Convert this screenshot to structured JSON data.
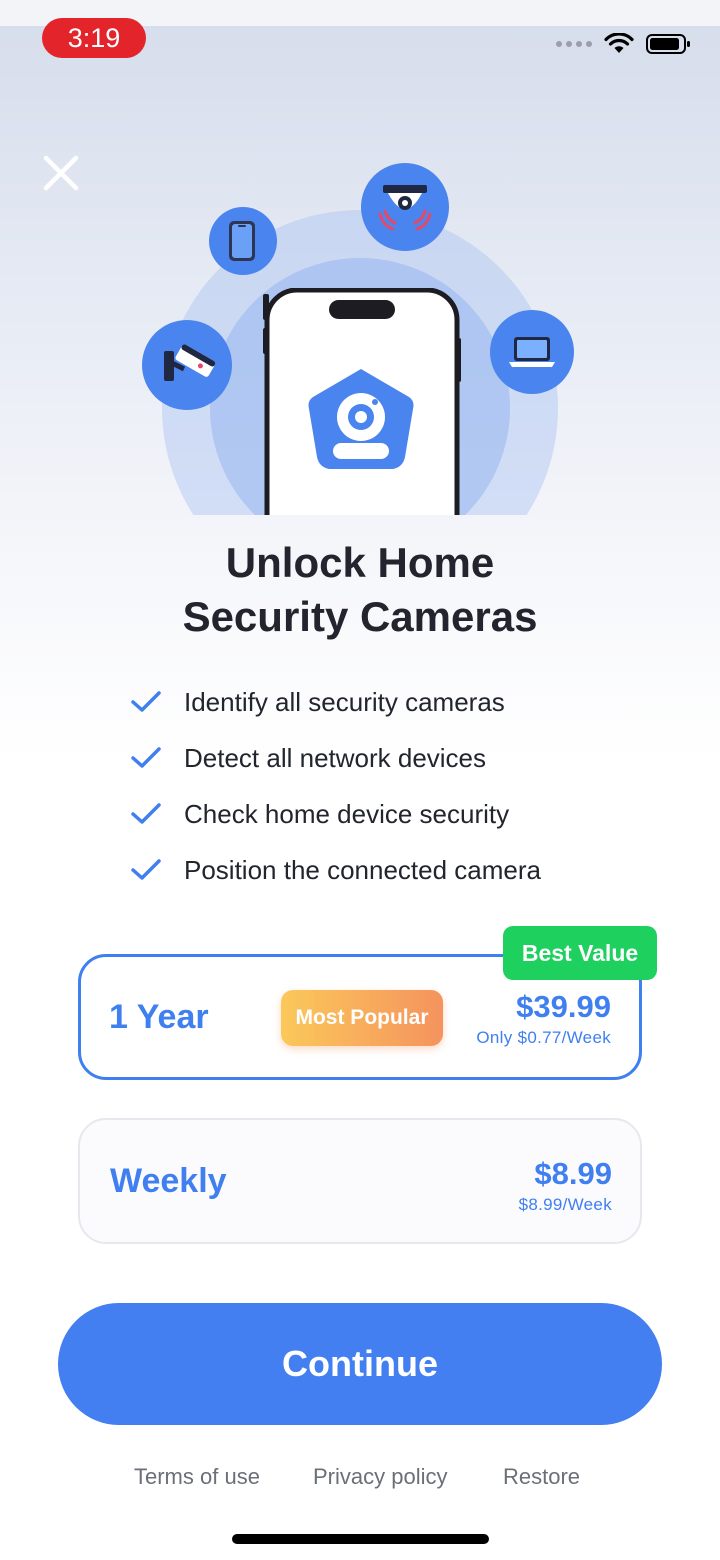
{
  "status_bar": {
    "time": "3:19"
  },
  "header": {
    "close_icon": "close-icon"
  },
  "hero": {
    "icons": [
      "smartphone-icon",
      "dome-camera-icon",
      "cctv-camera-icon",
      "laptop-icon",
      "home-camera-icon"
    ]
  },
  "title": {
    "line1": "Unlock Home",
    "line2": "Security Cameras"
  },
  "features": [
    "Identify all security cameras",
    "Detect all network devices",
    "Check home device security",
    "Position the connected camera"
  ],
  "plans": [
    {
      "name": "1 Year",
      "badge": "Most Popular",
      "corner_badge": "Best Value",
      "price": "$39.99",
      "per_week": "Only $0.77/Week",
      "selected": true
    },
    {
      "name": "Weekly",
      "price": "$8.99",
      "per_week": "$8.99/Week",
      "selected": false
    }
  ],
  "cta": {
    "label": "Continue"
  },
  "footer": {
    "terms": "Terms of use",
    "privacy": "Privacy policy",
    "restore": "Restore"
  },
  "colors": {
    "accent": "#437ff0",
    "best_value": "#1ed15f",
    "time_pill": "#e3242b"
  }
}
